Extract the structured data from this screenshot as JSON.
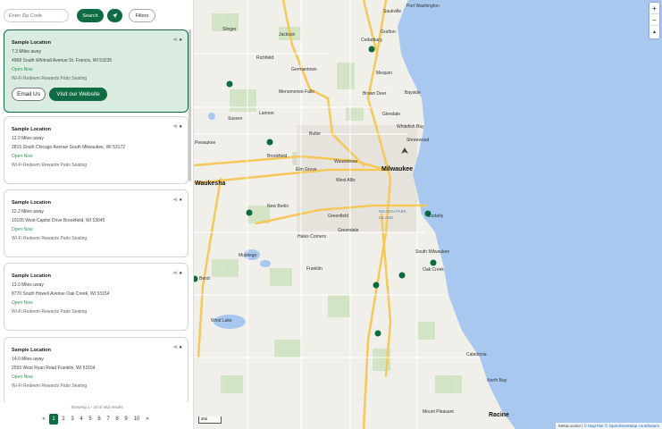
{
  "search": {
    "placeholder": "Enter Zip Code",
    "search_label": "Search",
    "filters_label": "Filters"
  },
  "locations": [
    {
      "title": "Sample Location",
      "distance": "7.3 Miles away",
      "address": "4968 South Whitnall Avenue St. Francis, WI 53235",
      "status": "Open Now",
      "features": "Wi-Fi  Redeem Rewards  Patio Seating",
      "active": true
    },
    {
      "title": "Sample Location",
      "distance": "12.0 Miles away",
      "address": "2815 South Chicago Avenue South Milwaukee, WI 53172",
      "status": "Open Now",
      "features": "Wi-Fi  Redeem Rewards  Patio Seating"
    },
    {
      "title": "Sample Location",
      "distance": "12.2 Miles away",
      "address": "19105 West Capitol Drive Brookfield, WI 53045",
      "status": "Open Now",
      "features": "Wi-Fi  Redeem Rewards  Patio Seating"
    },
    {
      "title": "Sample Location",
      "distance": "13.0 Miles away",
      "address": "8770 South Howell Avenue Oak Creek, WI 53154",
      "status": "Open Now",
      "features": "Wi-Fi  Redeem Rewards  Patio Seating"
    },
    {
      "title": "Sample Location",
      "distance": "14.0 Miles away",
      "address": "2555 West Ryan Road Franklin, WI 53154",
      "status": "Open Now",
      "features": "Wi-Fi  Redeem Rewards  Patio Seating"
    }
  ],
  "card_buttons": {
    "email": "Email Us",
    "website": "Visit our Website"
  },
  "showing": "Showing 1 - 10 of 462 results",
  "pagination": {
    "prev": "«",
    "pages": [
      "1",
      "2",
      "3",
      "4",
      "5",
      "6",
      "7",
      "8",
      "9",
      "10"
    ],
    "next": "»",
    "current": "1"
  },
  "map": {
    "zoom_in": "+",
    "zoom_out": "−",
    "compass": "▲",
    "scale": "2mi",
    "attribution_prefix": "MetaLocator | ",
    "attribution_links": [
      "© MapTiler",
      "© OpenStreetMap contributors"
    ],
    "labels": {
      "port_washington": "Port Washington",
      "saukville": "Saukville",
      "jackson": "Jackson",
      "slinger": "Slinger",
      "grafton": "Grafton",
      "cedarburg": "Cedarburg",
      "richfield": "Richfield",
      "germantown": "Germantown",
      "mequon": "Mequon",
      "menomonee_falls": "Menomonee Falls",
      "brown_deer": "Brown Deer",
      "bayside": "Bayside",
      "glendale": "Glendale",
      "whitefish_bay": "Whitefish Bay",
      "shorewood": "Shorewood",
      "lannon": "Lannon",
      "sussex": "Sussex",
      "butler": "Butler",
      "pewaukee": "Pewaukee",
      "brookfield": "Brookfield",
      "wauwatosa": "Wauwatosa",
      "elm_grove": "Elm Grove",
      "milwaukee": "Milwaukee",
      "waukesha": "Waukesha",
      "west_allis": "West Allis",
      "new_berlin": "New Berlin",
      "greenfield": "Greenfield",
      "wilson_park": "WILSON PARK ISLAND",
      "cudahy": "Cudahy",
      "greendale": "Greendale",
      "hales_corners": "Hales Corners",
      "south_milwaukee": "South Milwaukee",
      "muskego": "Muskego",
      "franklin": "Franklin",
      "oak_creek": "Oak Creek",
      "bend": "Bend",
      "wind_lake": "Wind Lake",
      "caledonia": "Caledonia",
      "north_bay": "North Bay",
      "mount_pleasant": "Mount Pleasant",
      "racine": "Racine"
    }
  }
}
